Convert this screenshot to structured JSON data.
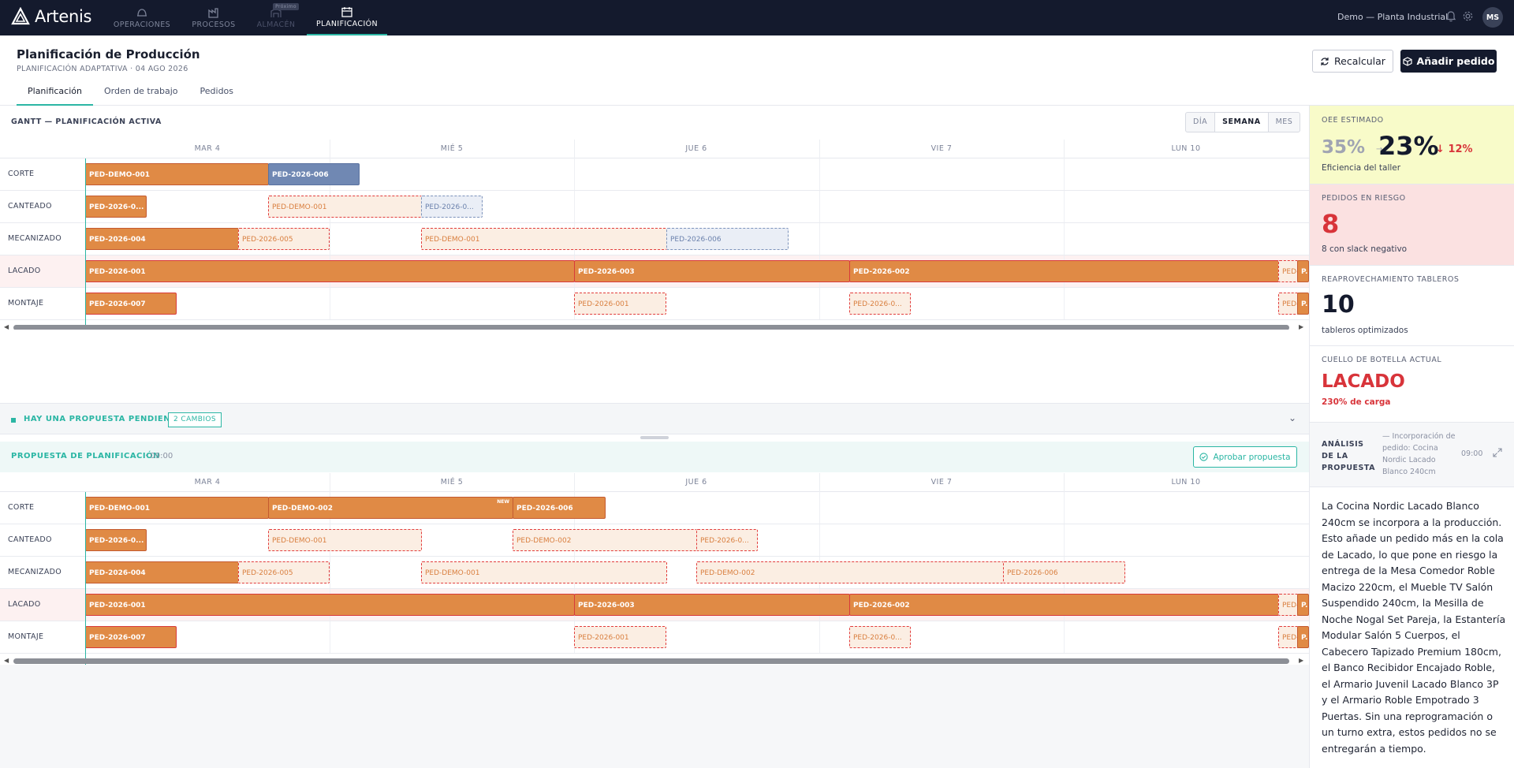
{
  "app": {
    "logo_text": "Artenis"
  },
  "nav": {
    "items": [
      {
        "label": "OPERACIONES",
        "icon": "hardhat-icon"
      },
      {
        "label": "PROCESOS",
        "icon": "factory-icon"
      },
      {
        "label": "ALMACÉN",
        "icon": "warehouse-icon",
        "badge": "Próximo"
      },
      {
        "label": "PLANIFICACIÓN",
        "icon": "calendar-icon"
      }
    ],
    "plant": "Demo — Planta Industrial",
    "avatar": "MS"
  },
  "header": {
    "title": "Planificación de Producción",
    "subtitle": "PLANIFICACIÓN ADAPTATIVA · 04 AGO 2026",
    "tabs": [
      "Planificación",
      "Orden de trabajo",
      "Pedidos"
    ],
    "recalc_label": "Recalcular",
    "add_label": "Añadir pedido"
  },
  "gantt": {
    "title": "GANTT — PLANIFICACIÓN ACTIVA",
    "views": [
      "DÍA",
      "SEMANA",
      "MES"
    ],
    "days": [
      "MAR 4",
      "MIÉ 5",
      "JUE 6",
      "VIE 7",
      "LUN 10"
    ],
    "rows": [
      "CORTE",
      "CANTEADO",
      "MECANIZADO",
      "LACADO",
      "MONTAJE"
    ],
    "bars": [
      [
        {
          "label": "PED-DEMO-001",
          "style": "solid"
        },
        {
          "label": "PED-2026-006",
          "style": "blue"
        }
      ],
      [
        {
          "label": "PED-2026-0...",
          "style": "solid"
        },
        {
          "label": "PED-DEMO-001",
          "style": "dash"
        },
        {
          "label": "PED-2026-0...",
          "style": "dashblue"
        }
      ],
      [
        {
          "label": "PED-2026-004",
          "style": "solid"
        },
        {
          "label": "PED-2026-005",
          "style": "dash"
        },
        {
          "label": "PED-DEMO-001",
          "style": "dash"
        },
        {
          "label": "PED-2026-006",
          "style": "dashblue"
        }
      ],
      [
        {
          "label": "PED-2026-001",
          "style": "solid"
        },
        {
          "label": "PED-2026-003",
          "style": "solid"
        },
        {
          "label": "PED-2026-002",
          "style": "solid"
        },
        {
          "label": "PED-...",
          "style": "dash"
        },
        {
          "label": "P...",
          "style": "solid"
        }
      ],
      [
        {
          "label": "PED-2026-007",
          "style": "solid"
        },
        {
          "label": "PED-2026-001",
          "style": "dash"
        },
        {
          "label": "PED-2026-0...",
          "style": "dash"
        },
        {
          "label": "PED-...",
          "style": "dash"
        },
        {
          "label": "P...",
          "style": "solid"
        }
      ]
    ]
  },
  "pending": {
    "text": "HAY UNA PROPUESTA PENDIENTE",
    "badge": "2 CAMBIOS"
  },
  "proposal": {
    "title": "PROPUESTA DE PLANIFICACIÓN",
    "time": "· 09:00",
    "approve_label": "Aprobar propuesta",
    "new_tag": "NEW",
    "bars": [
      [
        {
          "label": "PED-DEMO-001",
          "style": "solid"
        },
        {
          "label": "PED-DEMO-002",
          "style": "solid"
        },
        {
          "label": "PED-2026-006",
          "style": "solid"
        }
      ],
      [
        {
          "label": "PED-2026-0...",
          "style": "solid"
        },
        {
          "label": "PED-DEMO-001",
          "style": "dash"
        },
        {
          "label": "PED-DEMO-002",
          "style": "dash"
        },
        {
          "label": "PED-2026-0...",
          "style": "dash"
        }
      ],
      [
        {
          "label": "PED-2026-004",
          "style": "solid"
        },
        {
          "label": "PED-2026-005",
          "style": "dash"
        },
        {
          "label": "PED-DEMO-001",
          "style": "dash"
        },
        {
          "label": "PED-DEMO-002",
          "style": "dash"
        },
        {
          "label": "PED-2026-006",
          "style": "dash"
        }
      ],
      [
        {
          "label": "PED-2026-001",
          "style": "solid"
        },
        {
          "label": "PED-2026-003",
          "style": "solid"
        },
        {
          "label": "PED-2026-002",
          "style": "solid"
        },
        {
          "label": "PED-...",
          "style": "dash"
        },
        {
          "label": "P...",
          "style": "solid"
        }
      ],
      [
        {
          "label": "PED-2026-007",
          "style": "solid"
        },
        {
          "label": "PED-2026-001",
          "style": "dash"
        },
        {
          "label": "PED-2026-0...",
          "style": "dash"
        },
        {
          "label": "PED-...",
          "style": "dash"
        },
        {
          "label": "P...",
          "style": "solid"
        }
      ]
    ]
  },
  "kpis": {
    "oee": {
      "label": "OEE ESTIMADO",
      "previous": "35%",
      "current": "23%",
      "delta": "12%",
      "desc": "Eficiencia del taller"
    },
    "riesgo": {
      "label": "PEDIDOS EN RIESGO",
      "value": "8",
      "desc": "8 con slack negativo"
    },
    "tableros": {
      "label": "REAPROVECHAMIENTO TABLEROS",
      "value": "10",
      "desc": "tableros optimizados"
    },
    "cuello": {
      "label": "CUELLO DE BOTELLA ACTUAL",
      "value": "LACADO",
      "desc": "230% de carga"
    }
  },
  "analysis": {
    "label": "ANÁLISIS DE LA PROPUESTA",
    "subtitle": "— Incorporación de pedido: Cocina Nordic Lacado Blanco 240cm",
    "time": "09:00",
    "body": "La Cocina Nordic Lacado Blanco 240cm se incorpora a la producción. Esto añade un pedido más en la cola de Lacado, lo que pone en riesgo la entrega de la Mesa Comedor Roble Macizo 220cm, el Mueble TV Salón Suspendido 240cm, la Mesilla de Noche Nogal Set Pareja, la Estantería Modular Salón 5 Cuerpos, el Cabecero Tapizado Premium 180cm, el Banco Recibidor Encajado Roble, el Armario Juvenil Lacado Blanco 3P y el Armario Roble Empotrado 3 Puertas. Sin una reprogramación o un turno extra, estos pedidos no se entregarán a tiempo."
  }
}
